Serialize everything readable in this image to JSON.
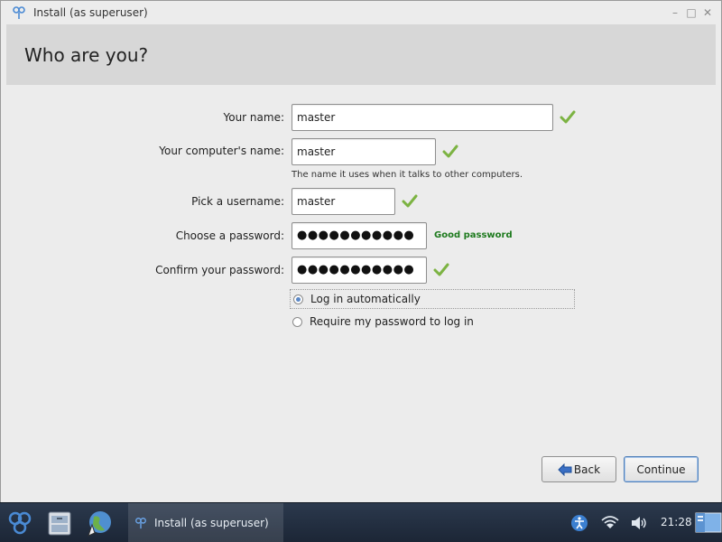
{
  "window": {
    "title": "Install (as superuser)",
    "controls": {
      "minimize": "–",
      "maximize": "□",
      "close": "✕"
    }
  },
  "page": {
    "heading": "Who are you?"
  },
  "form": {
    "your_name": {
      "label": "Your name:",
      "value": "master"
    },
    "computer_name": {
      "label": "Your computer's name:",
      "value": "master",
      "hint": "The name it uses when it talks to other computers."
    },
    "username": {
      "label": "Pick a username:",
      "value": "master"
    },
    "password": {
      "label": "Choose a password:",
      "value": "●●●●●●●●●●●",
      "strength": "Good password"
    },
    "confirm_password": {
      "label": "Confirm your password:",
      "value": "●●●●●●●●●●●"
    },
    "login_options": [
      {
        "label": "Log in automatically",
        "selected": true
      },
      {
        "label": "Require my password to log in",
        "selected": false
      }
    ]
  },
  "buttons": {
    "back": "Back",
    "continue": "Continue"
  },
  "taskbar": {
    "task_label": "Install (as superuser)",
    "clock": "21:28",
    "icons": [
      "lxqt-menu-icon",
      "file-manager-icon",
      "web-browser-icon",
      "accessibility-icon",
      "wifi-icon",
      "volume-icon",
      "show-desktop-icon"
    ]
  },
  "colors": {
    "accent": "#4f7fb8",
    "good": "#1d7a1d",
    "check": "#7cb342"
  }
}
